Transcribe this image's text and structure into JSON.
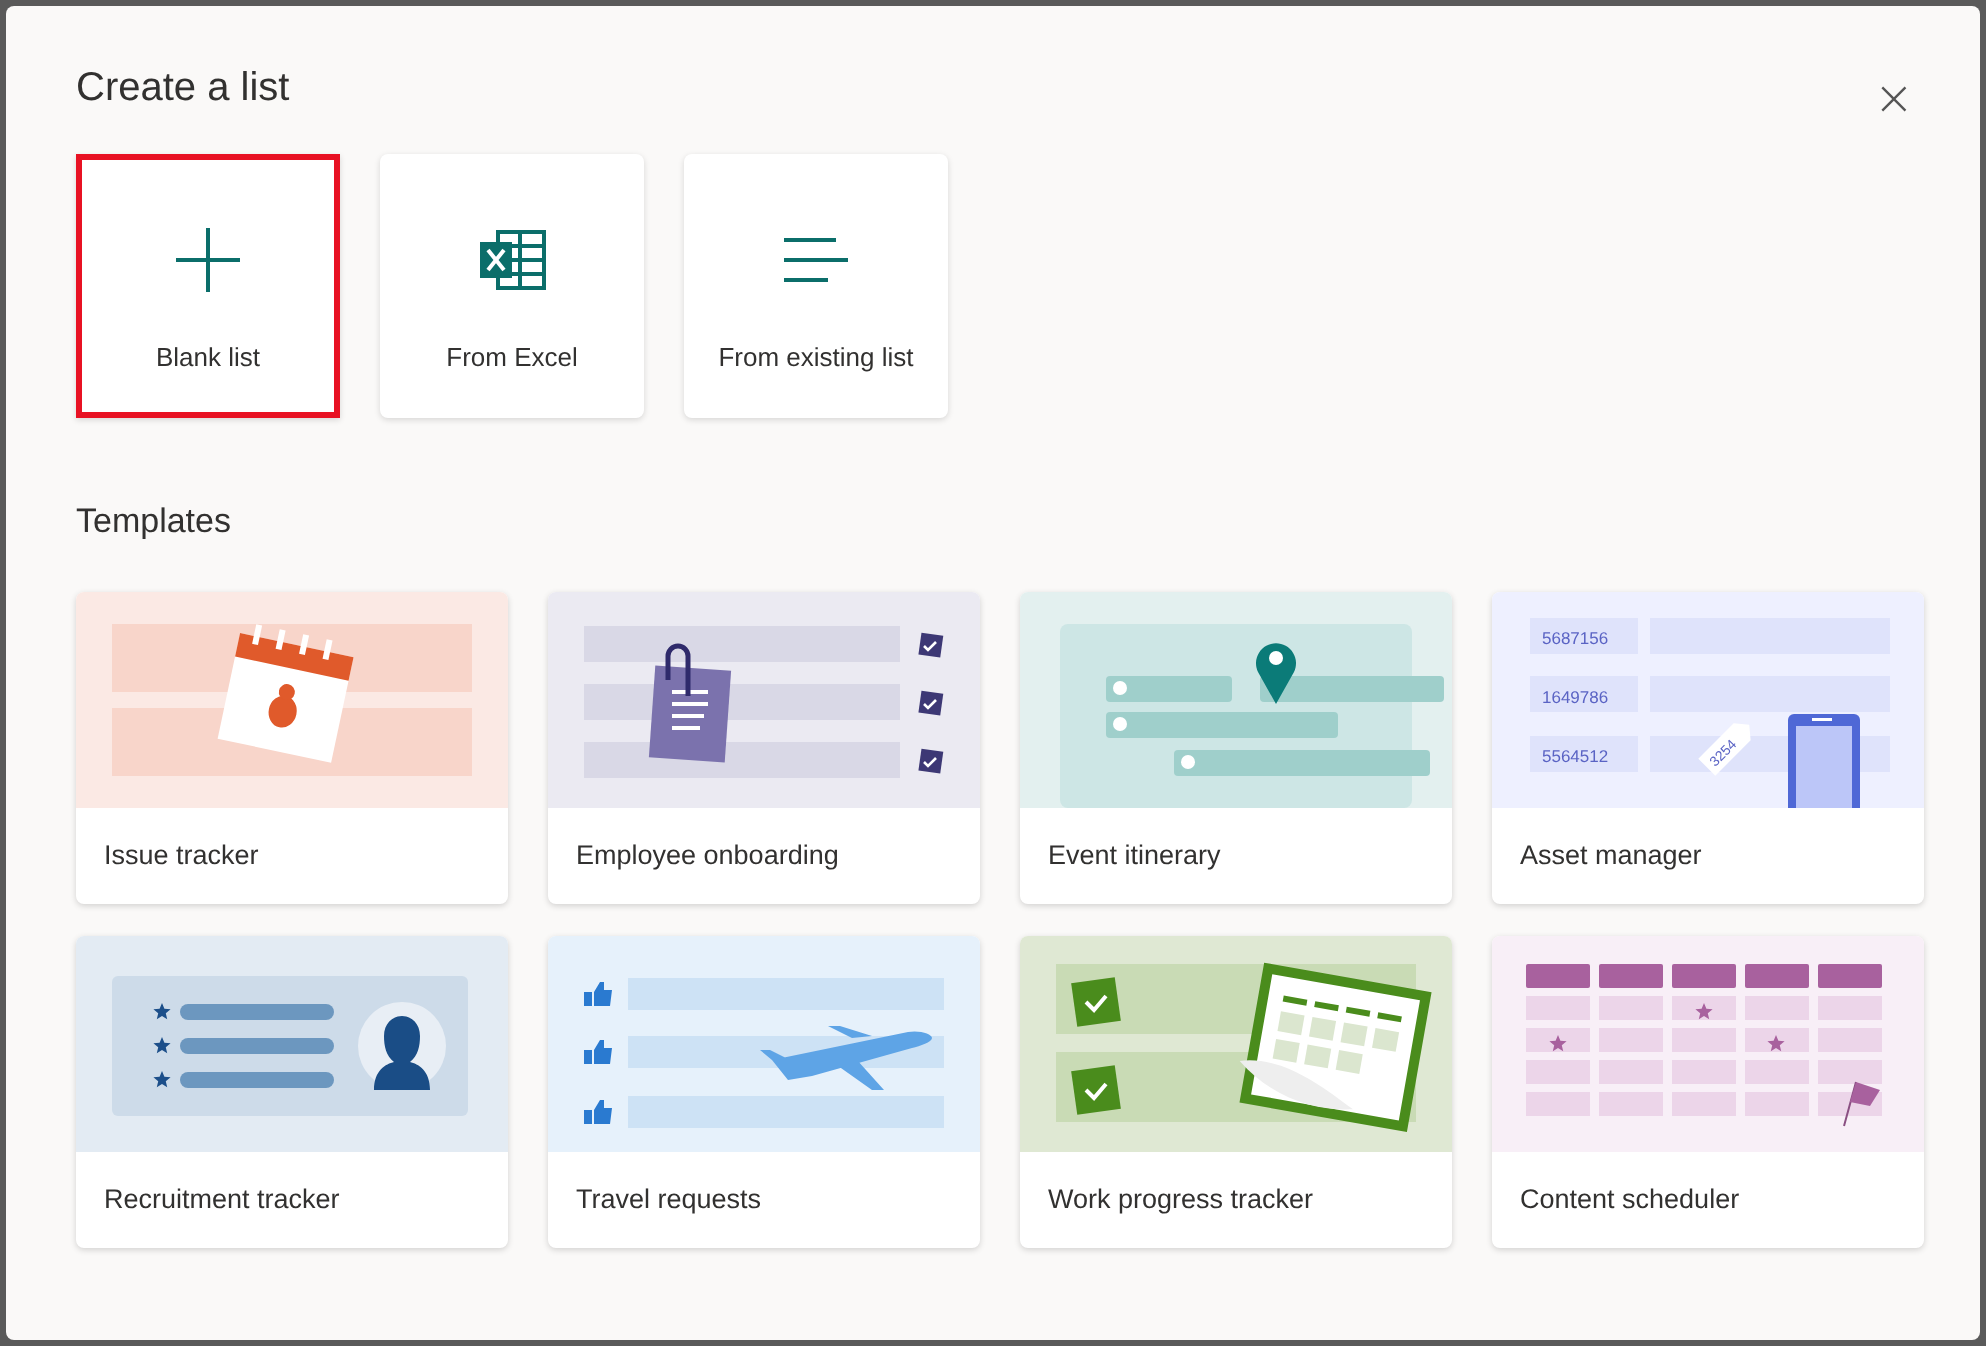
{
  "dialog": {
    "title": "Create a list",
    "close": "×"
  },
  "options": [
    {
      "label": "Blank list",
      "kind": "blank",
      "selected": true
    },
    {
      "label": "From Excel",
      "kind": "excel",
      "selected": false
    },
    {
      "label": "From existing list",
      "kind": "existing",
      "selected": false
    }
  ],
  "templates_heading": "Templates",
  "templates": [
    {
      "label": "Issue tracker",
      "kind": "issue"
    },
    {
      "label": "Employee onboarding",
      "kind": "onboarding"
    },
    {
      "label": "Event itinerary",
      "kind": "event"
    },
    {
      "label": "Asset manager",
      "kind": "asset",
      "numbers": [
        "5687156",
        "1649786",
        "5564512"
      ],
      "tag": "3254"
    },
    {
      "label": "Recruitment tracker",
      "kind": "recruitment"
    },
    {
      "label": "Travel requests",
      "kind": "travel"
    },
    {
      "label": "Work progress tracker",
      "kind": "work"
    },
    {
      "label": "Content scheduler",
      "kind": "content"
    }
  ]
}
